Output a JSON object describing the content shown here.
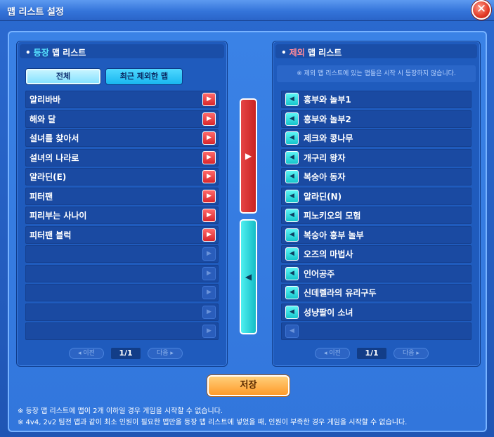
{
  "window": {
    "title": "맵 리스트 설정",
    "close_label": "✕"
  },
  "left": {
    "title_highlight": "등장",
    "title_rest": " 맵 리스트",
    "tabs": {
      "all": "전체",
      "recent": "최근 제외한 맵"
    },
    "maps": [
      "알리바바",
      "해와 달",
      "설녀를 찾아서",
      "설녀의 나라로",
      "알라딘(E)",
      "피터팬",
      "피리부는 사나이",
      "피터팬 블럭"
    ],
    "pager": {
      "prev": "◂ 이전",
      "page": "1/1",
      "next": "다음 ▸"
    }
  },
  "right": {
    "title_highlight": "제외",
    "title_rest": " 맵 리스트",
    "notice": "※ 제외 맵 리스트에 있는 맵들은 시작 시 등장하지 않습니다.",
    "maps": [
      "흥부와 놀부1",
      "흥부와 놀부2",
      "제크와 콩나무",
      "개구리 왕자",
      "복숭아 동자",
      "알라딘(N)",
      "피노키오의 모험",
      "복숭아 흥부 놀부",
      "오즈의 마법사",
      "인어공주",
      "신데렐라의 유리구두",
      "성냥팔이 소녀"
    ],
    "pager": {
      "prev": "◂ 이전",
      "page": "1/1",
      "next": "다음 ▸"
    }
  },
  "buttons": {
    "save": "저장",
    "move_right": "▶",
    "move_left": "◀"
  },
  "footnotes": [
    "※ 등장 맵 리스트에 맵이 2개 이하일 경우 게임을 시작할 수 없습니다.",
    "※ 4v4, 2v2 팀전 맵과 같이 최소 인원이 필요한 맵만을 등장 맵 리스트에 넣었을 때, 인원이 부족한 경우 게임을 시작할 수 없습니다."
  ],
  "icons": {
    "add_arrow": "arrow-right-icon",
    "remove_arrow": "arrow-left-icon"
  },
  "colors": {
    "left_arrow": "#d9252b",
    "right_arrow": "#15c5cc",
    "save": "#ff9b2a"
  }
}
